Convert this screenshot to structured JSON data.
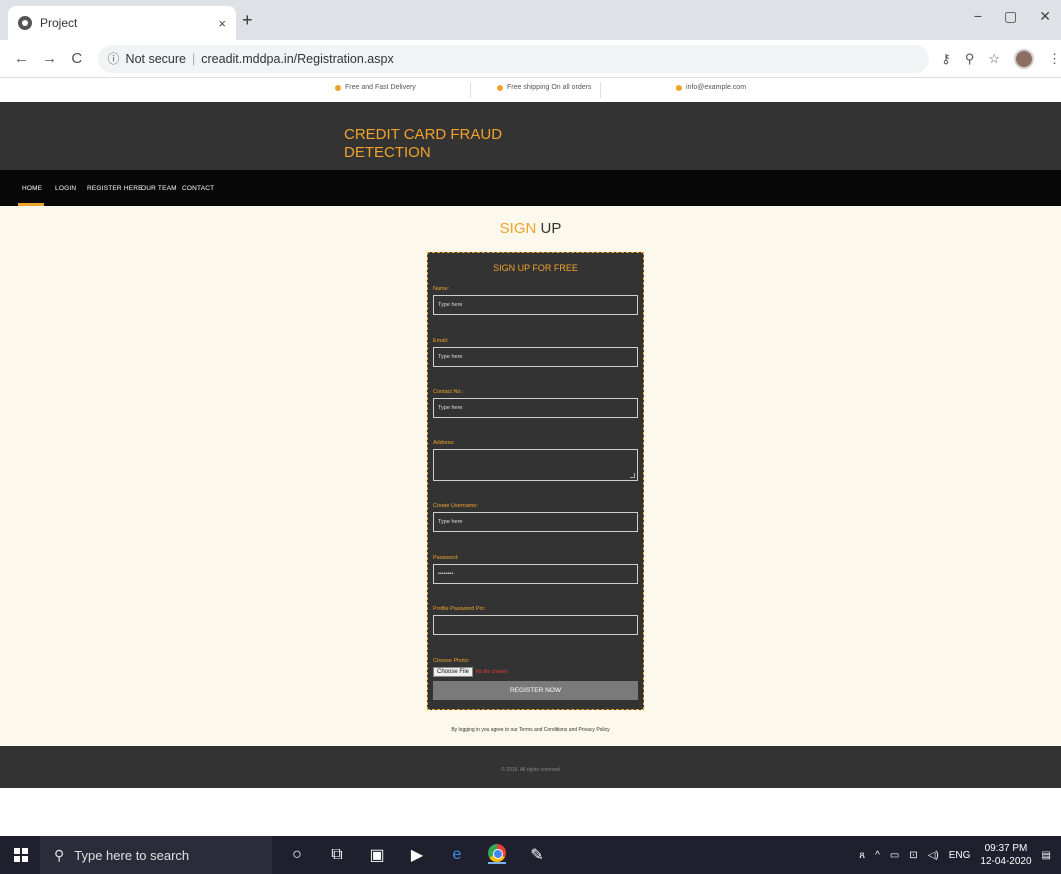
{
  "browser": {
    "tab_title": "Project",
    "tab_close": "×",
    "new_tab": "+",
    "window_controls": [
      "−",
      "▢",
      "✕"
    ],
    "nav": {
      "back": "←",
      "forward": "→",
      "reload": "C"
    },
    "security_icon": "ⓘ",
    "security_label": "Not secure",
    "url": "creadit.mddpa.in/Registration.aspx",
    "right_icons": {
      "key": "⚷",
      "zoom": "⚲",
      "star": "☆",
      "menu": "⋮"
    }
  },
  "top_info": {
    "delivery": "Free and Fast Delivery",
    "shipping": "Free shipping On all orders",
    "email": "info@example.com"
  },
  "brand": {
    "line1": "CREDIT CARD FRAUD",
    "line2": "DETECTION"
  },
  "nav": [
    "HOME",
    "LOGIN",
    "REGISTER HERE",
    "OUR TEAM",
    "CONTACT"
  ],
  "page": {
    "heading_accent": "SIGN",
    "heading_rest": " UP",
    "form_title": "SIGN UP FOR FREE",
    "fields": {
      "name_label": "Name:",
      "name_placeholder": "Type here",
      "email_label": "Email:",
      "email_placeholder": "Type here",
      "contact_label": "Contact No.:",
      "contact_placeholder": "Type here",
      "address_label": "Address:",
      "username_label": "Create Username:",
      "username_placeholder": "Type here",
      "password_label": "Password:",
      "password_value": "••••••••",
      "pin_label": "Profile Password Pin:",
      "photo_label": "Choose Photo:",
      "choose_file": "Choose File",
      "no_file": "No file chosen"
    },
    "register_button": "REGISTER NOW",
    "terms": "By logging in you agree to our Terms and Conditions and Privacy Policy"
  },
  "footer": {
    "copyright": "© 2019. All rights reserved"
  },
  "taskbar": {
    "search_placeholder": "Type here to search",
    "language": "ENG",
    "time": "09:37 PM",
    "date": "12-04-2020"
  },
  "colors": {
    "accent": "#f0a32c",
    "dark": "#333333",
    "nav_bg": "#080808",
    "page_bg": "#fdf8ec"
  }
}
